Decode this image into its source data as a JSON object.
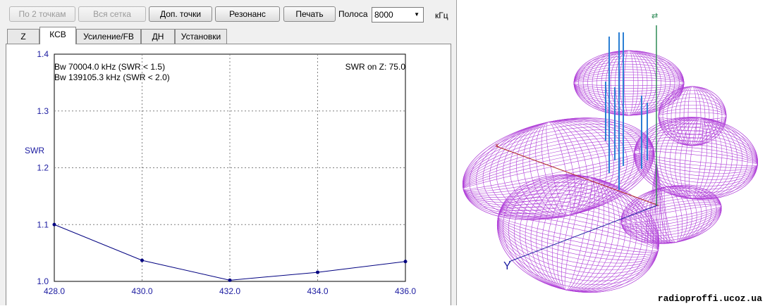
{
  "toolbar": {
    "btn_two_points": "По 2 точкам",
    "btn_full_grid": "Вся сетка",
    "btn_extra_points": "Доп. точки",
    "btn_resonance": "Резонанс",
    "btn_print": "Печать",
    "band_label": "Полоса",
    "band_value": "8000",
    "band_unit": "кГц"
  },
  "tabs": [
    "Z",
    "КСВ",
    "Усиление/FB",
    "ДН",
    "Установки"
  ],
  "active_tab": "КСВ",
  "chart": {
    "info_line1": "Bw 70004.0 kHz (SWR < 1.5)",
    "info_line2": "Bw 139105.3 kHz (SWR < 2.0)",
    "swr_on_z": "SWR on Z: 75.0"
  },
  "chart_data": {
    "type": "line",
    "title": "",
    "xlabel": "",
    "ylabel": "SWR",
    "x": [
      428.0,
      430.0,
      432.0,
      434.0,
      436.0
    ],
    "series": [
      {
        "values": [
          1.1,
          1.037,
          1.002,
          1.016,
          1.035
        ]
      }
    ],
    "xlim": [
      428.0,
      436.0
    ],
    "ylim": [
      1.0,
      1.4
    ],
    "x_ticks": [
      "428.0",
      "430.0",
      "432.0",
      "434.0",
      "436.0"
    ],
    "y_ticks": [
      "1.0",
      "1.1",
      "1.2",
      "1.3",
      "1.4"
    ],
    "grid": true,
    "colors": {
      "line": "#000080",
      "axis_text": "#1a1aa0",
      "grid": "#808080"
    }
  },
  "pattern": {
    "y_axis_label": "Y",
    "watermark": "radioproffi.ucoz.ua",
    "colors": {
      "mesh": "#b040d8",
      "elements": "#2a7fd4",
      "z_axis": "#2e8b57",
      "x_axis": "#b02a2a"
    }
  }
}
